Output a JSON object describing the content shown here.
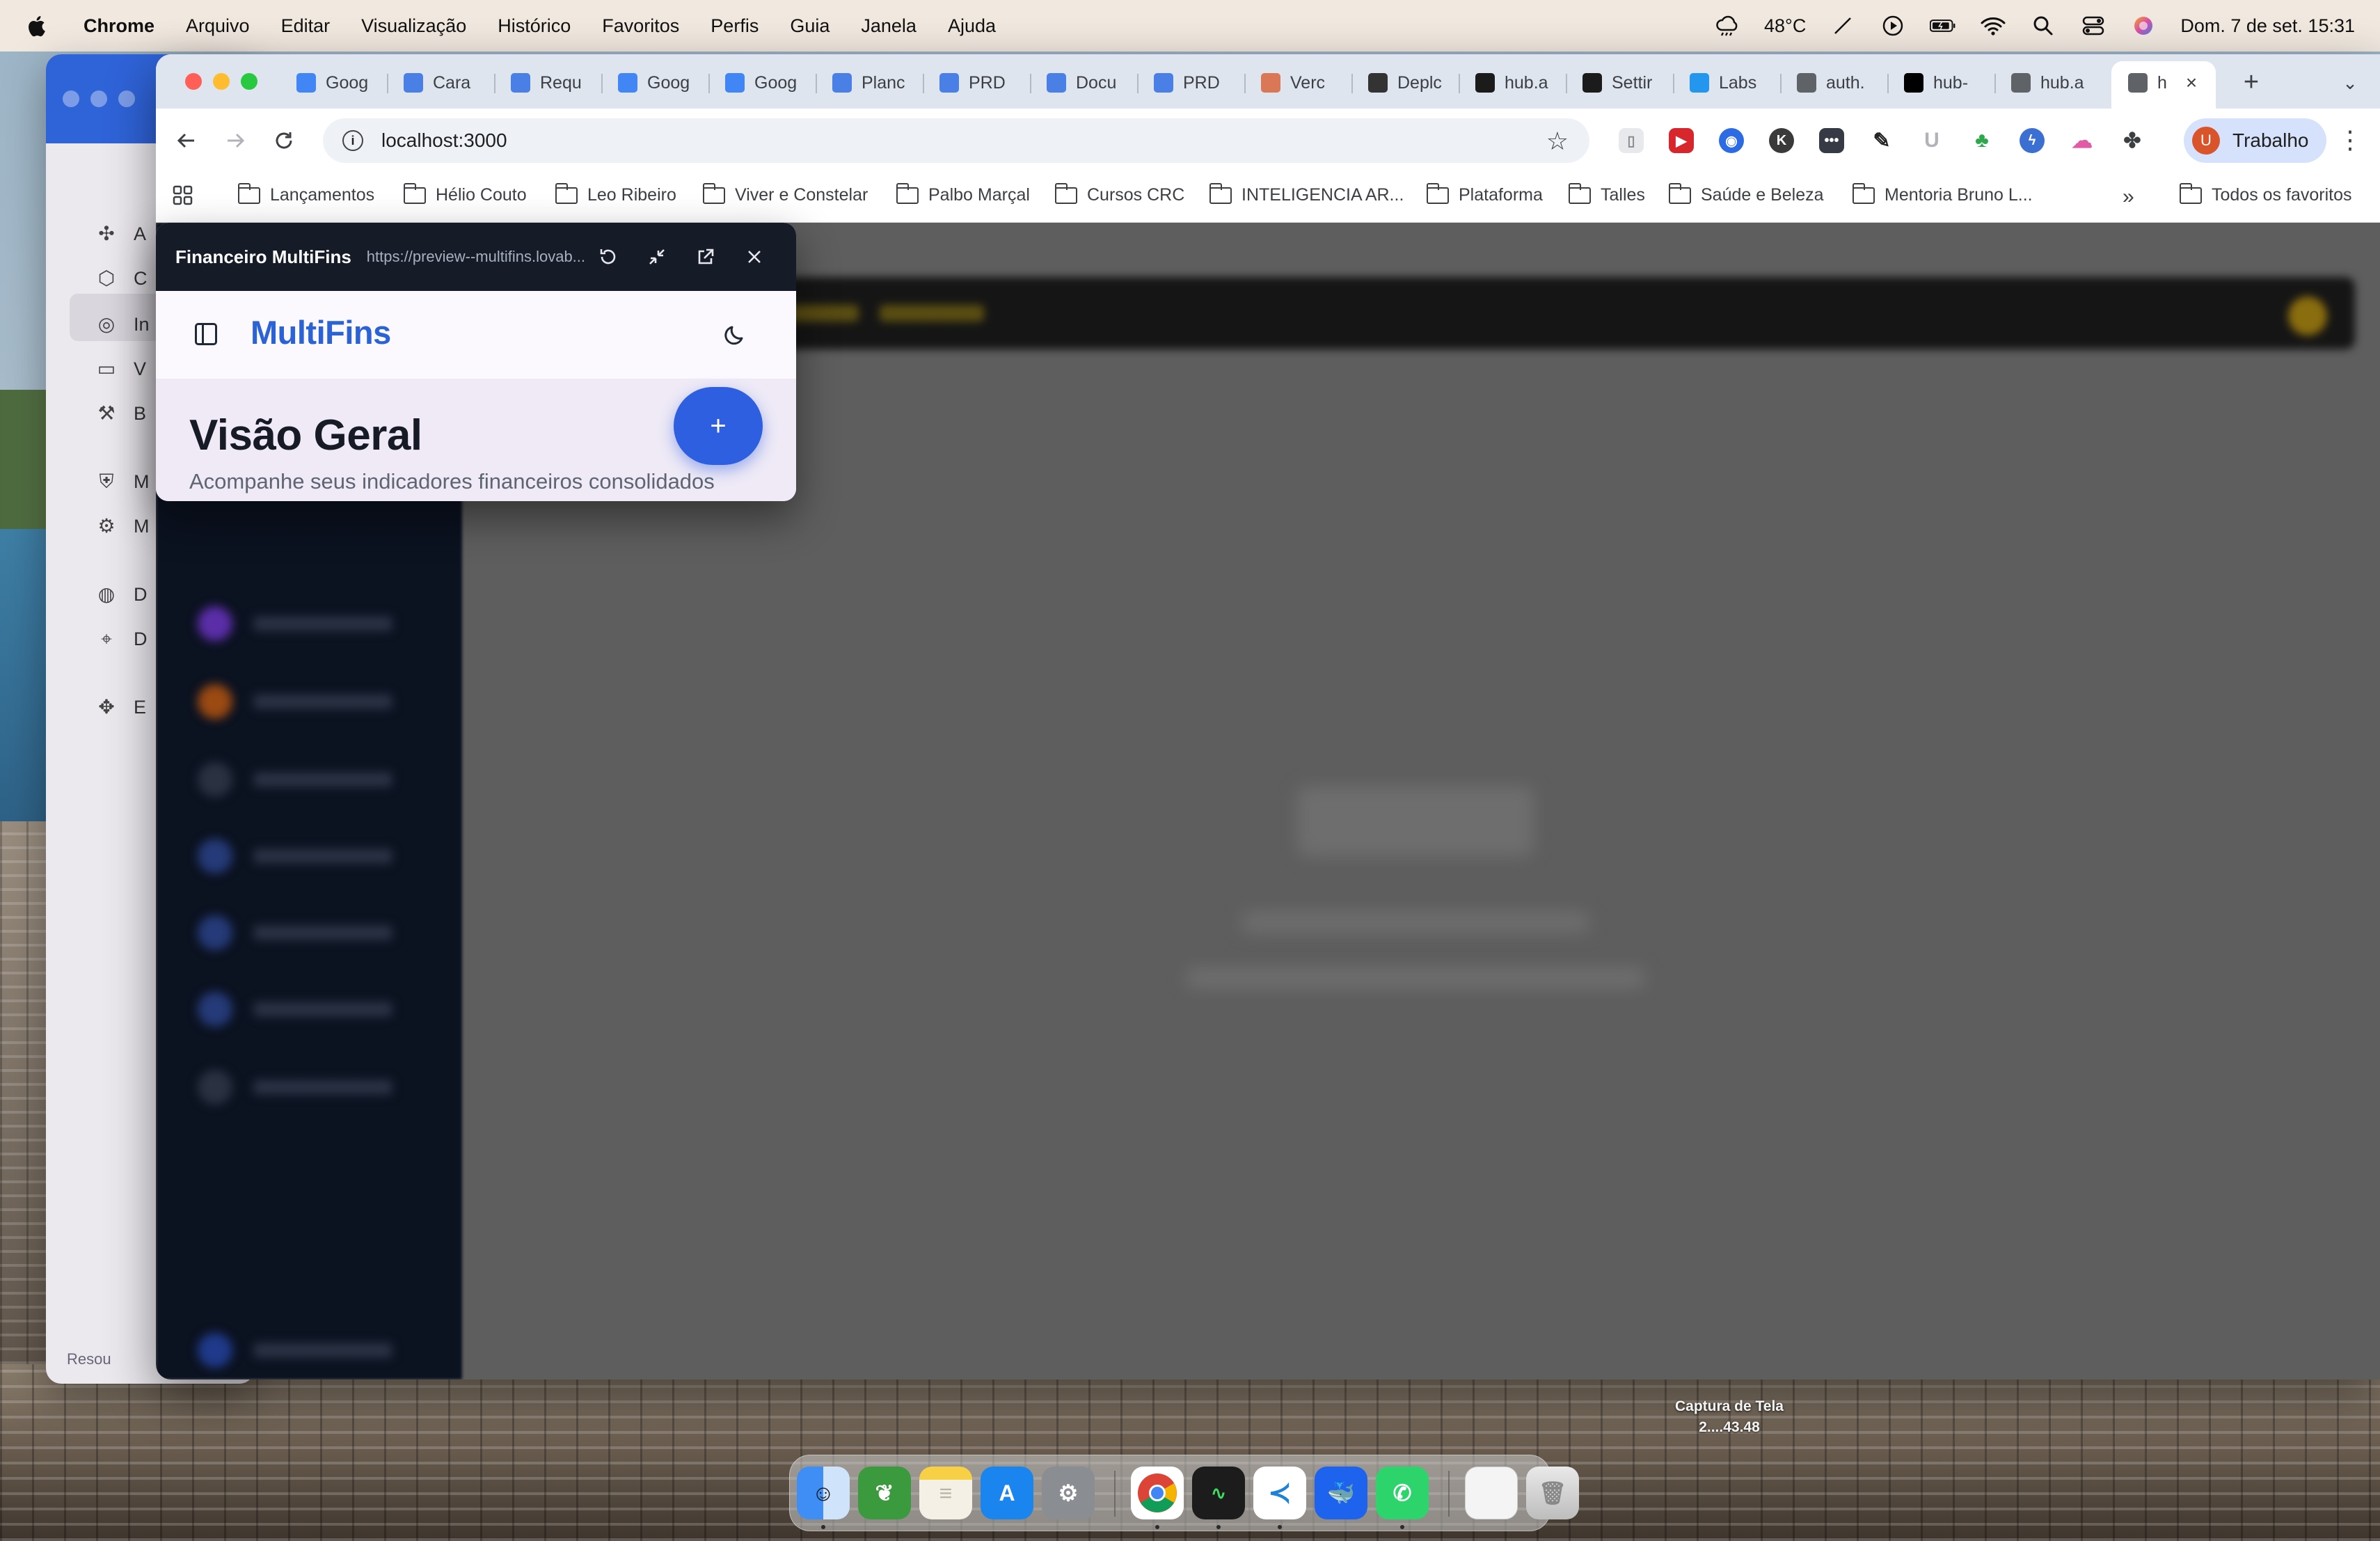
{
  "menubar": {
    "app_name": "Chrome",
    "menus": [
      "Arquivo",
      "Editar",
      "Visualização",
      "Histórico",
      "Favoritos",
      "Perfis",
      "Guia",
      "Janela",
      "Ajuda"
    ],
    "temperature": "48°C",
    "datetime": "Dom. 7 de set.  15:31",
    "icons": [
      "weather-icon",
      "no-pencil-icon",
      "play-icon",
      "battery-icon",
      "wifi-icon",
      "search-icon",
      "control-center-icon",
      "siri-icon"
    ]
  },
  "back_window": {
    "items": [
      "A",
      "C",
      "In",
      "V",
      "B",
      "M",
      "M",
      "D",
      "D",
      "E"
    ],
    "footer": "Resou"
  },
  "tabs": [
    {
      "label": "Goog",
      "icon": "gemini-icon",
      "color": "#4285f4"
    },
    {
      "label": "Cara",
      "icon": "docs-icon",
      "color": "#4a7fe6"
    },
    {
      "label": "Requ",
      "icon": "docs-icon",
      "color": "#4a7fe6"
    },
    {
      "label": "Goog",
      "icon": "gemini-icon",
      "color": "#4285f4"
    },
    {
      "label": "Goog",
      "icon": "gemini-icon",
      "color": "#4285f4"
    },
    {
      "label": "Planc",
      "icon": "docs-icon",
      "color": "#4a7fe6"
    },
    {
      "label": "PRD",
      "icon": "docs-icon",
      "color": "#4a7fe6"
    },
    {
      "label": "Docu",
      "icon": "docs-icon",
      "color": "#4a7fe6"
    },
    {
      "label": "PRD",
      "icon": "docs-icon",
      "color": "#4a7fe6"
    },
    {
      "label": "Verc",
      "icon": "claude-icon",
      "color": "#d97757"
    },
    {
      "label": "Deplc",
      "icon": "copilot-icon",
      "color": "#333333"
    },
    {
      "label": "hub.a",
      "icon": "supabase-icon",
      "color": "#1b1b1b"
    },
    {
      "label": "Settir",
      "icon": "supabase-icon",
      "color": "#1b1b1b"
    },
    {
      "label": "Labs",
      "icon": "docker-icon",
      "color": "#2496ed"
    },
    {
      "label": "auth.",
      "icon": "globe-icon",
      "color": "#5f6368"
    },
    {
      "label": "hub-",
      "icon": "vercel-icon",
      "color": "#000000"
    },
    {
      "label": "hub.a",
      "icon": "globe-icon",
      "color": "#5f6368"
    },
    {
      "label": "h",
      "icon": "globe-icon",
      "color": "#5f6368"
    }
  ],
  "toolbar": {
    "url": "localhost:3000",
    "profile_label": "Trabalho",
    "profile_initial": "U"
  },
  "bookmarks": [
    "Lançamentos",
    "Hélio Couto",
    "Leo Ribeiro",
    "Viver e Constelar",
    "Palbo Marçal",
    "Cursos CRC",
    "INTELIGENCIA AR...",
    "Plataforma",
    "Talles",
    "Saúde e Beleza",
    "Mentoria Bruno L..."
  ],
  "bookmarks_all": "Todos os favoritos",
  "panel": {
    "title": "Financeiro MultiFins",
    "url": "https://preview--multifins.lovab...",
    "brand": "MultiFins",
    "page_title": "Visão Geral",
    "page_subtitle": "Acompanhe seus indicadores financeiros consolidados",
    "fab_label": "+"
  },
  "dock": {
    "apps": [
      "finder",
      "books",
      "notes",
      "app-store",
      "system-settings",
      "chrome",
      "activity-monitor",
      "vscode",
      "docker",
      "whatsapp",
      "document",
      "trash"
    ]
  },
  "screenshot_label": "Captura de Tela 2....43.48",
  "colors": {
    "brand_blue": "#2b62d6",
    "fab_blue": "#2e5fe0",
    "panel_header": "#151b27",
    "profile_chip": "#d6e2fb"
  }
}
